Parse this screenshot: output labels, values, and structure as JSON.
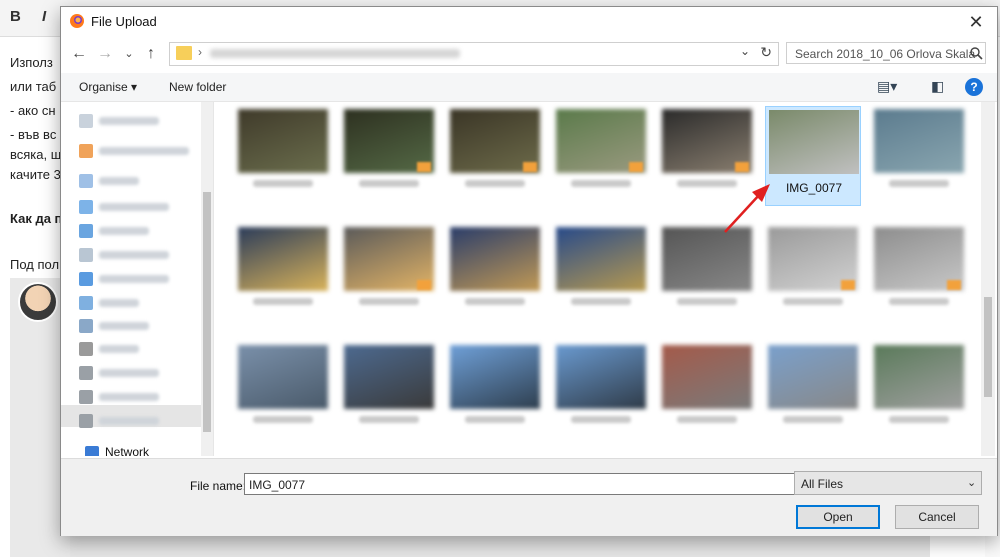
{
  "background": {
    "toolbar": {
      "bold_label": "B",
      "italic_label": "I"
    },
    "text_lines": [
      "Използ",
      "или таб",
      "- ако сн",
      "- във вс",
      "всяка, щ",
      "качите 3",
      "Как да п",
      "Под пол"
    ]
  },
  "dialog": {
    "title": "File Upload",
    "search_placeholder": "Search 2018_10_06 Orlova Skala",
    "toolbar": {
      "organise_label": "Organise ▾",
      "new_folder_label": "New folder"
    },
    "sidebar": {
      "network_label": "Network"
    },
    "selected_file_label": "IMG_0077",
    "filename_label": "File name:",
    "filename_value": "IMG_0077",
    "filetype_value": "All Files",
    "open_label": "Open",
    "cancel_label": "Cancel"
  },
  "thumbnails": [
    {
      "row": 0,
      "col": 0,
      "c1": "#3f3a2a",
      "c2": "#6b6e4d"
    },
    {
      "row": 0,
      "col": 1,
      "c1": "#2d3020",
      "c2": "#556a46",
      "badge": true
    },
    {
      "row": 0,
      "col": 2,
      "c1": "#3a3526",
      "c2": "#6d6b4a",
      "badge": true
    },
    {
      "row": 0,
      "col": 3,
      "c1": "#5a7a4a",
      "c2": "#9a9a80",
      "badge": true
    },
    {
      "row": 0,
      "col": 4,
      "c1": "#2a2a2a",
      "c2": "#8a7f70",
      "badge": true
    },
    {
      "row": 0,
      "col": 5,
      "c1": "#7a8a6a",
      "c2": "#c0c0c0",
      "selected": true
    },
    {
      "row": 0,
      "col": 6,
      "c1": "#5b7b8e",
      "c2": "#8aa6b0"
    },
    {
      "row": 1,
      "col": 0,
      "c1": "#2b3c5a",
      "c2": "#d9b35a"
    },
    {
      "row": 1,
      "col": 1,
      "c1": "#5a5a5a",
      "c2": "#e3b466",
      "badge": true
    },
    {
      "row": 1,
      "col": 2,
      "c1": "#2a3d6a",
      "c2": "#c29a55"
    },
    {
      "row": 1,
      "col": 3,
      "c1": "#274a8a",
      "c2": "#b79a50"
    },
    {
      "row": 1,
      "col": 4,
      "c1": "#555555",
      "c2": "#888888"
    },
    {
      "row": 1,
      "col": 5,
      "c1": "#9a9a9a",
      "c2": "#d2d2d2",
      "badge": true
    },
    {
      "row": 1,
      "col": 6,
      "c1": "#8d8d8d",
      "c2": "#c8c8c8",
      "badge": true
    },
    {
      "row": 2,
      "col": 0,
      "c1": "#7a90aa",
      "c2": "#4a5a6a"
    },
    {
      "row": 2,
      "col": 1,
      "c1": "#4d6a90",
      "c2": "#3a3a3a"
    },
    {
      "row": 2,
      "col": 2,
      "c1": "#6fa0d8",
      "c2": "#2e3e4e"
    },
    {
      "row": 2,
      "col": 3,
      "c1": "#6a9ad0",
      "c2": "#2f3b48"
    },
    {
      "row": 2,
      "col": 4,
      "c1": "#a45a4a",
      "c2": "#7a7a7a"
    },
    {
      "row": 2,
      "col": 5,
      "c1": "#7aa0cc",
      "c2": "#888888"
    },
    {
      "row": 2,
      "col": 6,
      "c1": "#5a7a5a",
      "c2": "#a0a0a0"
    }
  ]
}
